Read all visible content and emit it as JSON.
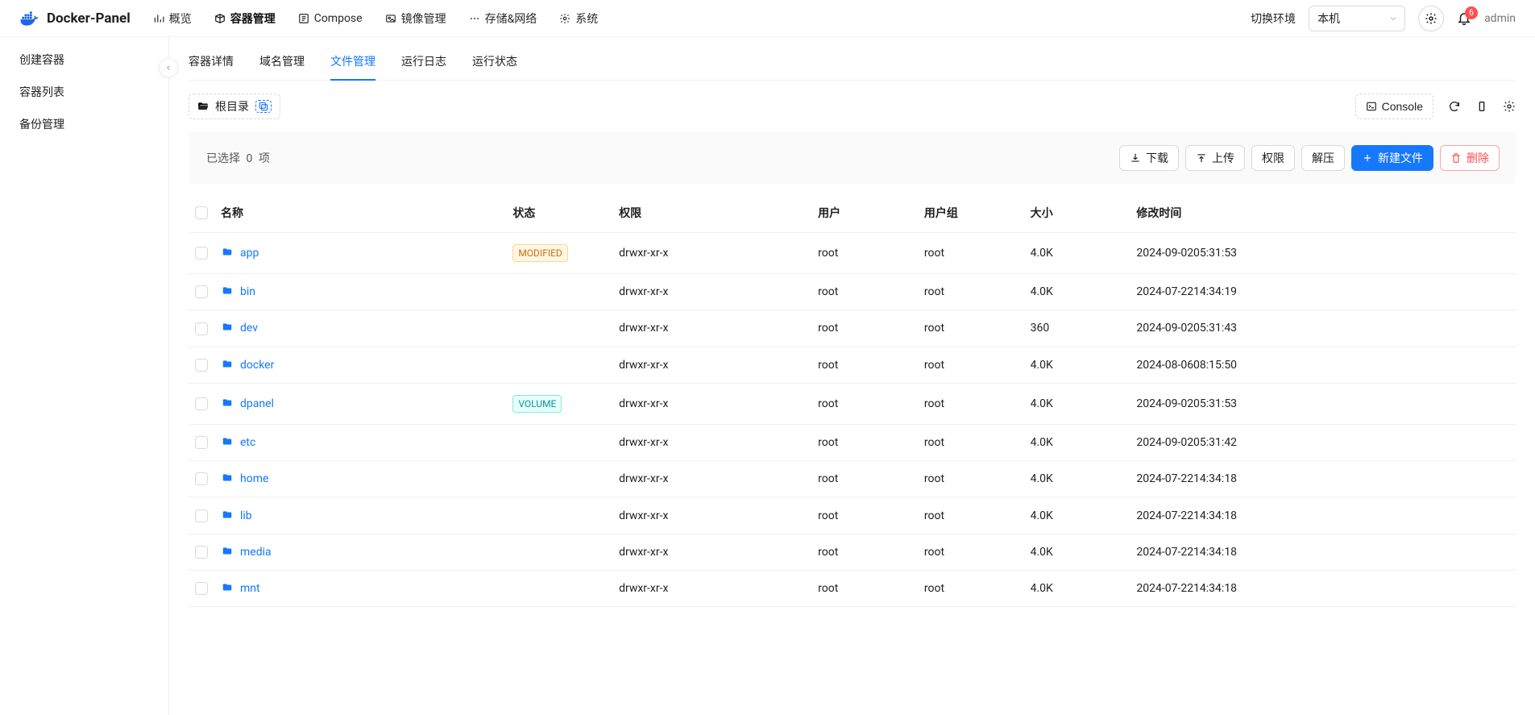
{
  "brand": "Docker-Panel",
  "topmenu": [
    {
      "label": "概览",
      "active": false
    },
    {
      "label": "容器管理",
      "active": true
    },
    {
      "label": "Compose",
      "active": false
    },
    {
      "label": "镜像管理",
      "active": false
    },
    {
      "label": "存储&网络",
      "active": false
    },
    {
      "label": "系统",
      "active": false
    }
  ],
  "topright": {
    "switch_label": "切换环境",
    "env": "本机",
    "badge": "6",
    "user": "admin"
  },
  "sidebar": {
    "items": [
      {
        "label": "创建容器"
      },
      {
        "label": "容器列表"
      },
      {
        "label": "备份管理"
      }
    ]
  },
  "tabs": [
    {
      "label": "容器详情",
      "active": false
    },
    {
      "label": "域名管理",
      "active": false
    },
    {
      "label": "文件管理",
      "active": true
    },
    {
      "label": "运行日志",
      "active": false
    },
    {
      "label": "运行状态",
      "active": false
    }
  ],
  "breadcrumb": {
    "root": "根目录"
  },
  "console_label": "Console",
  "selection": {
    "prefix": "已选择",
    "count": "0",
    "suffix": "项"
  },
  "buttons": {
    "download": "下载",
    "upload": "上传",
    "perm": "权限",
    "unzip": "解压",
    "newfile": "新建文件",
    "delete": "删除"
  },
  "columns": {
    "name": "名称",
    "status": "状态",
    "perm": "权限",
    "user": "用户",
    "group": "用户组",
    "size": "大小",
    "mtime": "修改时间"
  },
  "status_tags": {
    "modified": "MODIFIED",
    "volume": "VOLUME"
  },
  "rows": [
    {
      "name": "app",
      "status": "modified",
      "perm": "drwxr-xr-x",
      "user": "root",
      "group": "root",
      "size": "4.0K",
      "mtime": "2024-09-0205:31:53"
    },
    {
      "name": "bin",
      "status": "",
      "perm": "drwxr-xr-x",
      "user": "root",
      "group": "root",
      "size": "4.0K",
      "mtime": "2024-07-2214:34:19"
    },
    {
      "name": "dev",
      "status": "",
      "perm": "drwxr-xr-x",
      "user": "root",
      "group": "root",
      "size": "360",
      "mtime": "2024-09-0205:31:43"
    },
    {
      "name": "docker",
      "status": "",
      "perm": "drwxr-xr-x",
      "user": "root",
      "group": "root",
      "size": "4.0K",
      "mtime": "2024-08-0608:15:50"
    },
    {
      "name": "dpanel",
      "status": "volume",
      "perm": "drwxr-xr-x",
      "user": "root",
      "group": "root",
      "size": "4.0K",
      "mtime": "2024-09-0205:31:53"
    },
    {
      "name": "etc",
      "status": "",
      "perm": "drwxr-xr-x",
      "user": "root",
      "group": "root",
      "size": "4.0K",
      "mtime": "2024-09-0205:31:42"
    },
    {
      "name": "home",
      "status": "",
      "perm": "drwxr-xr-x",
      "user": "root",
      "group": "root",
      "size": "4.0K",
      "mtime": "2024-07-2214:34:18"
    },
    {
      "name": "lib",
      "status": "",
      "perm": "drwxr-xr-x",
      "user": "root",
      "group": "root",
      "size": "4.0K",
      "mtime": "2024-07-2214:34:18"
    },
    {
      "name": "media",
      "status": "",
      "perm": "drwxr-xr-x",
      "user": "root",
      "group": "root",
      "size": "4.0K",
      "mtime": "2024-07-2214:34:18"
    },
    {
      "name": "mnt",
      "status": "",
      "perm": "drwxr-xr-x",
      "user": "root",
      "group": "root",
      "size": "4.0K",
      "mtime": "2024-07-2214:34:18"
    }
  ]
}
